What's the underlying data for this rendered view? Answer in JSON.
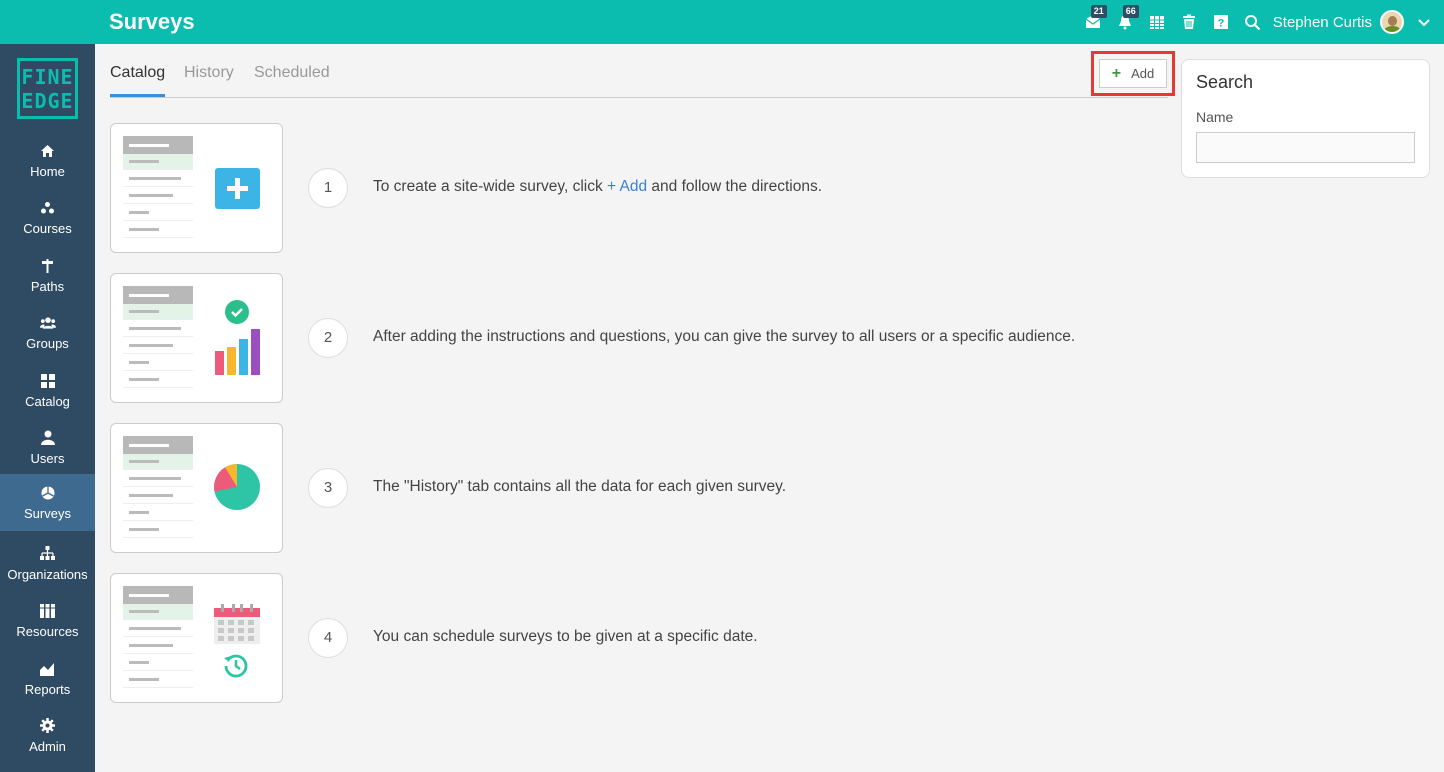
{
  "header": {
    "title": "Surveys",
    "messages_badge": "21",
    "notifications_badge": "66",
    "user_name": "Stephen Curtis"
  },
  "logo": {
    "line1": "FINE",
    "line2": "EDGE"
  },
  "sidebar": {
    "items": [
      {
        "label": "Home",
        "icon": "home-icon"
      },
      {
        "label": "Courses",
        "icon": "courses-icon"
      },
      {
        "label": "Paths",
        "icon": "paths-icon"
      },
      {
        "label": "Groups",
        "icon": "groups-icon"
      },
      {
        "label": "Catalog",
        "icon": "catalog-icon"
      },
      {
        "label": "Users",
        "icon": "users-icon"
      },
      {
        "label": "Surveys",
        "icon": "surveys-icon",
        "active": true
      },
      {
        "label": "Organizations",
        "icon": "organizations-icon"
      },
      {
        "label": "Resources",
        "icon": "resources-icon"
      },
      {
        "label": "Reports",
        "icon": "reports-icon"
      },
      {
        "label": "Admin",
        "icon": "gear-icon"
      }
    ]
  },
  "tabs": [
    {
      "label": "Catalog",
      "active": true
    },
    {
      "label": "History",
      "active": false
    },
    {
      "label": "Scheduled",
      "active": false
    }
  ],
  "toolbar": {
    "add_label": "Add"
  },
  "search": {
    "title": "Search",
    "name_label": "Name",
    "name_value": ""
  },
  "steps": [
    {
      "number": "1",
      "text_before": "To create a site-wide survey, click ",
      "link": "+ Add",
      "text_after": " and follow the directions."
    },
    {
      "number": "2",
      "text": "After adding the instructions and questions, you can give the survey to all users or a specific audience."
    },
    {
      "number": "3",
      "text": "The \"History\" tab contains all the data for each given survey."
    },
    {
      "number": "4",
      "text": "You can schedule surveys to be given at a specific date."
    }
  ],
  "colors": {
    "accent": "#0bbdae",
    "sidebar": "#2f4b63",
    "sidebar_active": "#3d6a8e",
    "highlight": "#e53935"
  }
}
